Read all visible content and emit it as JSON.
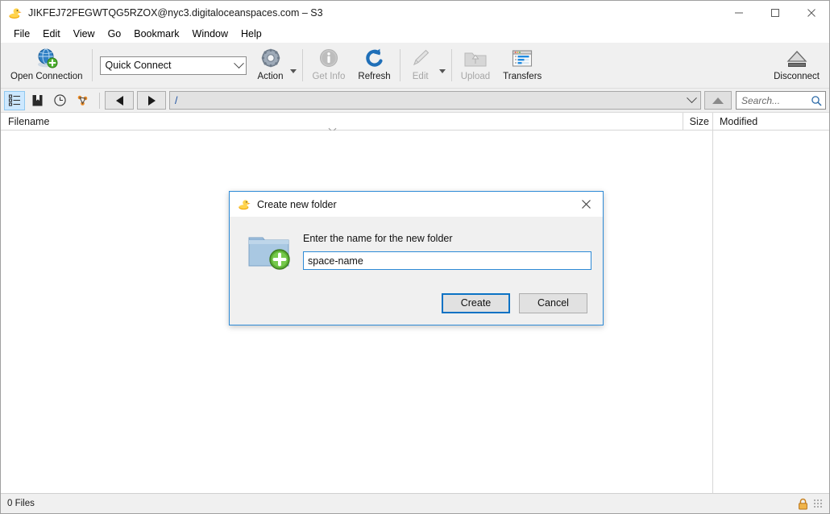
{
  "window": {
    "title": "JIKFEJ72FEGWTQG5RZOX@nyc3.digitaloceanspaces.com – S3",
    "app_icon": "duck-icon",
    "controls": {
      "minimize": "—",
      "maximize": "☐",
      "close": "✕"
    }
  },
  "menubar": {
    "items": [
      {
        "label": "File"
      },
      {
        "label": "Edit"
      },
      {
        "label": "View"
      },
      {
        "label": "Go"
      },
      {
        "label": "Bookmark"
      },
      {
        "label": "Window"
      },
      {
        "label": "Help"
      }
    ]
  },
  "toolbar": {
    "open_connection": {
      "label": "Open Connection",
      "icon": "globe-plus-icon",
      "disabled": false
    },
    "quick_connect": {
      "value": "Quick Connect",
      "icon": "chevron-down-icon"
    },
    "action": {
      "label": "Action",
      "icon": "gear-icon",
      "disabled": false
    },
    "get_info": {
      "label": "Get Info",
      "icon": "info-icon",
      "disabled": true
    },
    "refresh": {
      "label": "Refresh",
      "icon": "refresh-icon",
      "disabled": false
    },
    "edit": {
      "label": "Edit",
      "icon": "pencil-icon",
      "disabled": true
    },
    "upload": {
      "label": "Upload",
      "icon": "upload-folder-icon",
      "disabled": true
    },
    "transfers": {
      "label": "Transfers",
      "icon": "transfers-window-icon",
      "disabled": false
    },
    "disconnect": {
      "label": "Disconnect",
      "icon": "eject-icon",
      "disabled": false
    }
  },
  "navbar": {
    "view_browser": {
      "icon": "browser-list-icon",
      "selected": true
    },
    "view_bookmarks": {
      "icon": "bookmark-book-icon",
      "selected": false
    },
    "view_history": {
      "icon": "clock-history-icon",
      "selected": false
    },
    "view_bonjour": {
      "icon": "bonjour-icon",
      "selected": false
    },
    "back": {
      "icon": "triangle-left-icon"
    },
    "forward": {
      "icon": "triangle-right-icon"
    },
    "path": {
      "value": "/",
      "icon": "chevron-down-icon"
    },
    "up": {
      "icon": "triangle-up-icon"
    },
    "search": {
      "placeholder": "Search...",
      "value": "",
      "icon": "search-icon"
    }
  },
  "columns": {
    "filename": "Filename",
    "size": "Size",
    "modified": "Modified"
  },
  "statusbar": {
    "files": "0 Files",
    "lock_icon": "padlock-icon",
    "grip_icon": "resize-grip-icon"
  },
  "dialog": {
    "icon": "duck-icon",
    "title": "Create new folder",
    "close_label": "✕",
    "folder_icon": "new-folder-icon",
    "prompt": "Enter the name for the new folder",
    "input": {
      "value": "space-name",
      "placeholder": ""
    },
    "create_label": "Create",
    "cancel_label": "Cancel"
  },
  "colors": {
    "accent": "#0b72c4",
    "dialog_border": "#2d8ad6",
    "toolbar_bg": "#f0f0f0",
    "selected_tab": "#cde8ff",
    "path_text": "#1a4fa0"
  }
}
